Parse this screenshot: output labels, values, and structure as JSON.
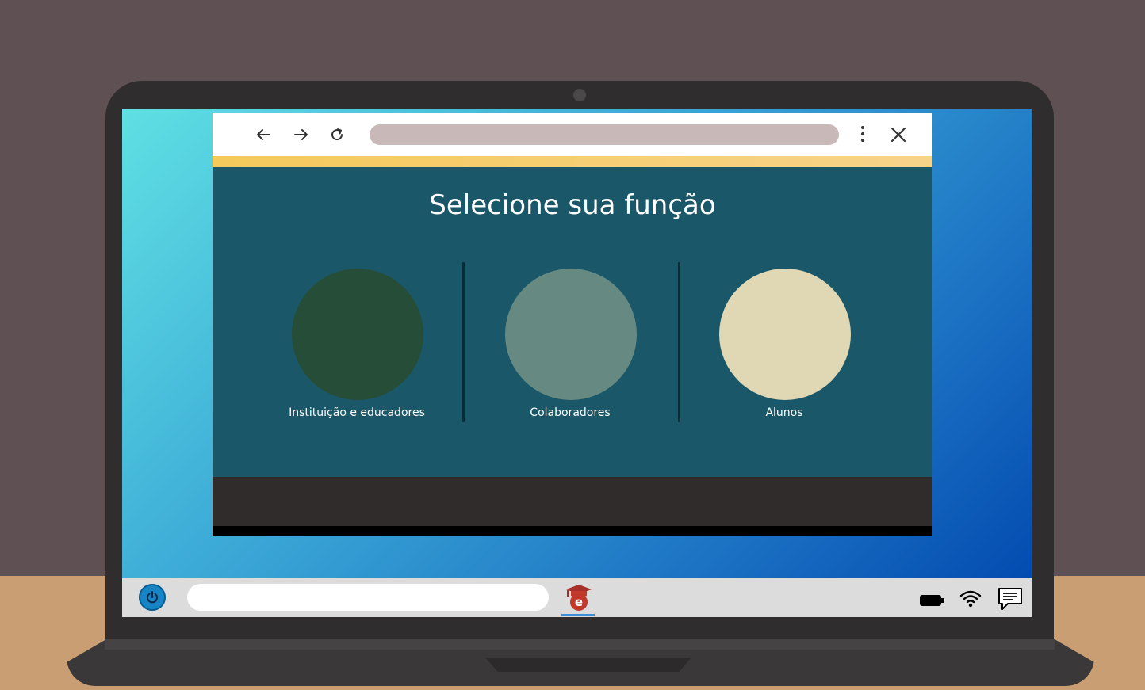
{
  "browser": {
    "back_icon": "arrow-left-icon",
    "forward_icon": "arrow-right-icon",
    "reload_icon": "reload-icon",
    "address_value": "",
    "menu_icon": "vertical-dots-icon",
    "close_icon": "close-icon",
    "accent_color": "#f6c95b"
  },
  "page": {
    "title": "Selecione sua função",
    "background_color": "#1a5869",
    "options": [
      {
        "label": "Instituição e educadores",
        "color": "#264d38"
      },
      {
        "label": "Colaboradores",
        "color": "#668a82"
      },
      {
        "label": "Alunos",
        "color": "#e0d8b5"
      }
    ]
  },
  "taskbar": {
    "power_icon": "power-icon",
    "search_value": "",
    "app_icon": "graduation-cap-e-icon",
    "tray": [
      "battery-icon",
      "wifi-icon",
      "chat-icon"
    ]
  }
}
